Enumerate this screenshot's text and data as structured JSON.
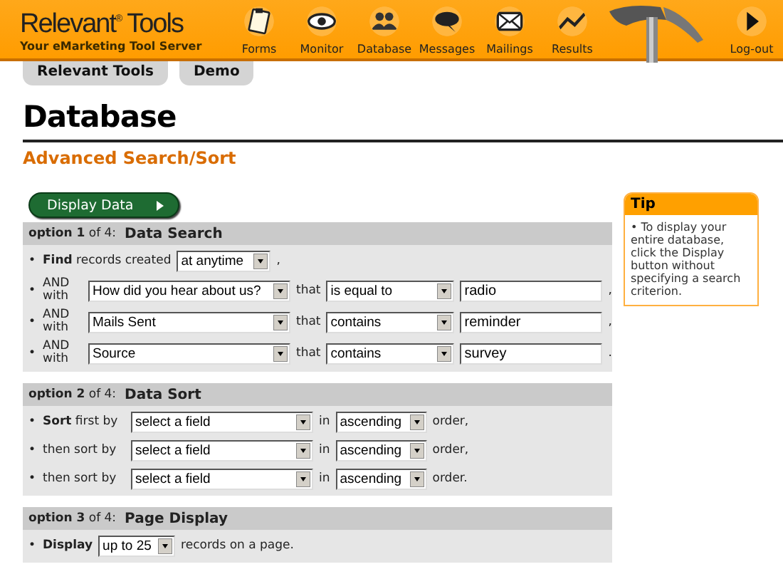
{
  "header": {
    "logo": "Relevant$^{®}$ Tools",
    "tagline": "Your eMarketing Tool Server",
    "nav": [
      {
        "kind": "forms",
        "label": "Forms"
      },
      {
        "kind": "monitor",
        "label": "Monitor"
      },
      {
        "kind": "database",
        "label": "Database"
      },
      {
        "kind": "messages",
        "label": "Messages"
      },
      {
        "kind": "mailings",
        "label": "Mailings"
      },
      {
        "kind": "results",
        "label": "Results"
      },
      {
        "kind": "logout",
        "label": "Log-out"
      }
    ]
  },
  "tabs": [
    {
      "label": "Relevant Tools"
    },
    {
      "label": "Demo"
    }
  ],
  "page": {
    "title": "Database",
    "subtitle": "Advanced Search/Sort",
    "button": "Display Data"
  },
  "sections": [
    {
      "option": "**option 1** of 4:",
      "title": "Data Search",
      "rows": [
        {
          "kind": "find",
          "bullet": "•",
          "lead": "**Find** records created",
          "select": "at anytime",
          "end": ","
        },
        {
          "kind": "condition",
          "bullet": "•",
          "lead": "AND with",
          "field": "How did you hear about us?",
          "joiner": "that",
          "operator": "is equal to",
          "value": "radio",
          "end": ","
        },
        {
          "kind": "condition",
          "bullet": "•",
          "lead": "AND with",
          "field": "Mails Sent",
          "joiner": "that",
          "operator": "contains",
          "value": "reminder",
          "end": ","
        },
        {
          "kind": "condition",
          "bullet": "•",
          "lead": "AND with",
          "field": "Source",
          "joiner": "that",
          "operator": "contains",
          "value": "survey",
          "end": "."
        }
      ]
    },
    {
      "option": "**option 2** of 4:",
      "title": "Data Sort",
      "rows": [
        {
          "kind": "sort",
          "bullet": "•",
          "lead": "**Sort** first by",
          "field": "select a field",
          "joiner": "in",
          "order": "ascending",
          "end": "order,"
        },
        {
          "kind": "sort",
          "bullet": "•",
          "lead": "then sort by",
          "field": "select a field",
          "joiner": "in",
          "order": "ascending",
          "end": "order,"
        },
        {
          "kind": "sort",
          "bullet": "•",
          "lead": "then sort by",
          "field": "select a field",
          "joiner": "in",
          "order": "ascending",
          "end": "order."
        }
      ]
    },
    {
      "option": "**option 3** of 4:",
      "title": "Page Display",
      "rows": [
        {
          "kind": "display",
          "bullet": "•",
          "lead": "**Display**",
          "select": "up to 25",
          "end": "records on a page."
        }
      ]
    }
  ],
  "tip": {
    "title": "Tip",
    "text": "• To display your entire database, click the Display button without specifying a search criterion."
  }
}
